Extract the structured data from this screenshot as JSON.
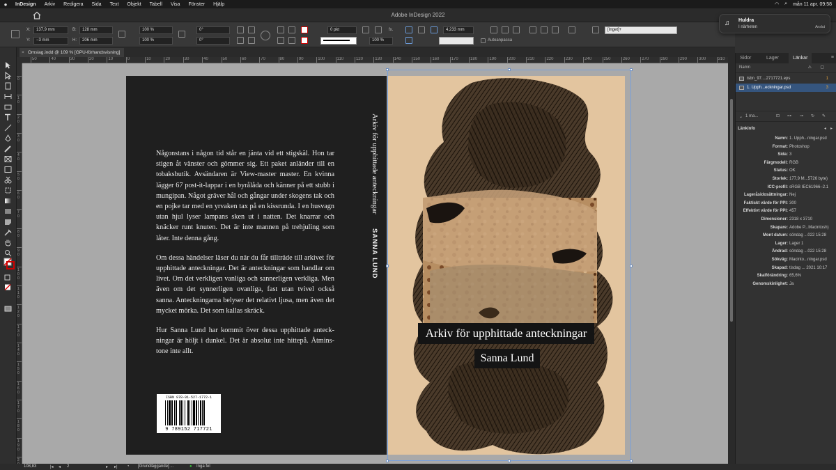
{
  "menubar": {
    "apple": "",
    "items": [
      "InDesign",
      "Arkiv",
      "Redigera",
      "Sida",
      "Text",
      "Objekt",
      "Tabell",
      "Visa",
      "Fönster",
      "Hjälp"
    ],
    "clock": "mån 11 apr. 09:58"
  },
  "app": {
    "title": "Adobe InDesign 2022"
  },
  "notification": {
    "title": "Huldra",
    "subtitle": "I närheten",
    "button": "Anslut"
  },
  "control": {
    "x_label": "X:",
    "x": "137,9 mm",
    "y_label": "Y:",
    "y": "−3 mm",
    "w_label": "B:",
    "w": "128 mm",
    "h_label": "H:",
    "h": "206 mm",
    "scale_x": "100 %",
    "scale_y": "100 %",
    "rotate": "0°",
    "shear": "0°",
    "stroke_weight": "0 pkt",
    "opacity": "100 %",
    "spacing": "4,233 mm",
    "autofit_label": "Autoanpassa",
    "style": "[Inget]+"
  },
  "document": {
    "tab": "Omslag.indd @ 109 % [GPU-förhandsvisning]"
  },
  "ruler": {
    "h_ticks": [
      "50",
      "40",
      "30",
      "20",
      "10",
      "0",
      "10",
      "20",
      "30",
      "40",
      "50",
      "60",
      "70",
      "80",
      "90",
      "100",
      "110",
      "120",
      "130",
      "140",
      "150",
      "160",
      "170",
      "180",
      "190",
      "200",
      "210",
      "220",
      "230",
      "240",
      "250",
      "260",
      "270",
      "280",
      "290",
      "300",
      "310"
    ],
    "v_ticks": [
      "0",
      "1\n0",
      "2\n0",
      "3\n0",
      "4\n0",
      "5\n0",
      "6\n0",
      "7\n0",
      "8\n0",
      "9\n0",
      "1\n0\n0",
      "1\n1\n0",
      "1\n2\n0",
      "1\n3\n0",
      "1\n4\n0",
      "1\n5\n0",
      "1\n6\n0",
      "1\n7\n0",
      "1\n8\n0",
      "1\n9\n0",
      "2\n0\n0"
    ]
  },
  "cover": {
    "blurb": [
      "Någonstans i någon tid står en jänta vid ett stigskäl. Hon tar stigen åt vänster och gömmer sig. Ett paket anländer till en tobaksbutik. Avsändaren är View-master master. En kvinna lägger 67 post-it-lappar i en byrålåda och känner på ett stubb i mungipan. Något gräver hål och gångar under skogens tak och en pojke tar med en yrvaken tax på en kissrunda. I en husvagn utan hjul lyser lampans sken ut i natten. Det knarrar och knäcker runt knuten. Det är inte mannen på trehjuling som låter. Inte denna gång.",
      "Om dessa händelser läser du när du får tillträde till arkivet för upphittade anteckningar. Det är anteckningar som handlar om livet. Om det verkligen vanliga och sannerligen verkliga. Men även om det synnerligen ovanliga, fast utan tvivel också sanna. Anteckningarna belyser det relativt ljusa, men även det mycket mörka. Det som kallas skräck.",
      "Hur Sanna Lund har kommit över dessa upphittade anteck­ningar är höljt i dunkel. Det är absolut inte hittepå. Åtmins­tone inte allt."
    ],
    "isbn_text": "ISBN 978-91-527-1772-1",
    "barcode_digits": "9 789152 717721",
    "spine_title": "Arkiv för upphittade anteckningar",
    "spine_author": "SANNA LUND",
    "front_title": "Arkiv för upphittade anteckningar",
    "front_author": "Sanna Lund"
  },
  "statusbar": {
    "zoom": "108,83",
    "page": "2",
    "style": "[Grundläggande] ...",
    "errors": "Inga fel"
  },
  "panel": {
    "tabs": [
      "Sidor",
      "Lager",
      "Länkar"
    ],
    "header_name": "Namn",
    "links": [
      {
        "name": "isbn_97....2717721.eps",
        "page": "1"
      },
      {
        "name": "1. Upph...eckningar.psd",
        "page": "3"
      }
    ],
    "count": "1 ma...",
    "linkinfo_title": "Länkinfo",
    "linkinfo": [
      {
        "k": "Namn:",
        "v": "1. Upph...ningar.psd"
      },
      {
        "k": "Format:",
        "v": "Photoshop"
      },
      {
        "k": "Sida:",
        "v": "3"
      },
      {
        "k": "Färgmodell:",
        "v": "RGB"
      },
      {
        "k": "Status:",
        "v": "OK"
      },
      {
        "k": "Storlek:",
        "v": "177,9 M...5726 byte)"
      },
      {
        "k": "ICC-profil:",
        "v": "sRGB IEC61966–2.1"
      },
      {
        "k": "Lageråsidosättningar:",
        "v": "Nej"
      },
      {
        "k": "Faktiskt värde för PPI:",
        "v": "300"
      },
      {
        "k": "Effektivt värde för PPI:",
        "v": "457"
      },
      {
        "k": "Dimensioner:",
        "v": "2318 x 3710"
      },
      {
        "k": "Skapare:",
        "v": "Adobe P...Macintosh)"
      },
      {
        "k": "Mont datum:",
        "v": "söndag ...022 15:28"
      },
      {
        "k": "Lager:",
        "v": "Lager 1"
      },
      {
        "k": "Ändrad:",
        "v": "söndag ...022 15:28"
      },
      {
        "k": "Sökväg:",
        "v": "Macinto...ningar.psd"
      },
      {
        "k": "Skapad:",
        "v": "tisdag ... 2021 10:17"
      },
      {
        "k": "Skalförändring:",
        "v": "65,6%"
      },
      {
        "k": "Genomskinlighet:",
        "v": "Ja"
      }
    ]
  }
}
